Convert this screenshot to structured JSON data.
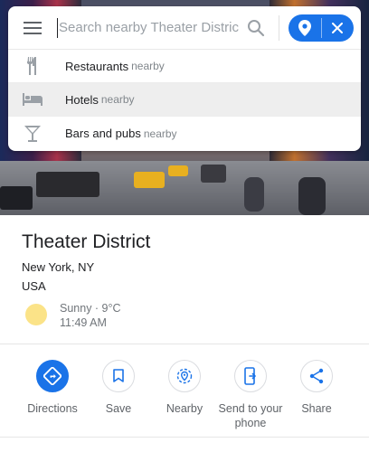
{
  "search": {
    "placeholder": "Search nearby Theater District"
  },
  "suggestions": [
    {
      "label": "Restaurants",
      "sub": "nearby",
      "icon": "fork-knife-icon"
    },
    {
      "label": "Hotels",
      "sub": "nearby",
      "icon": "bed-icon"
    },
    {
      "label": "Bars and pubs",
      "sub": "nearby",
      "icon": "cocktail-icon"
    }
  ],
  "place": {
    "title": "Theater District",
    "city": "New York, NY",
    "country": "USA"
  },
  "weather": {
    "condition": "Sunny · 9°C",
    "time": "11:49 AM"
  },
  "actions": [
    {
      "label": "Directions",
      "icon": "directions-icon"
    },
    {
      "label": "Save",
      "icon": "bookmark-icon"
    },
    {
      "label": "Nearby",
      "icon": "nearby-icon"
    },
    {
      "label": "Send to your phone",
      "icon": "send-to-phone-icon"
    },
    {
      "label": "Share",
      "icon": "share-icon"
    }
  ],
  "colors": {
    "accent": "#1a73e8",
    "sun": "#fbe388"
  }
}
